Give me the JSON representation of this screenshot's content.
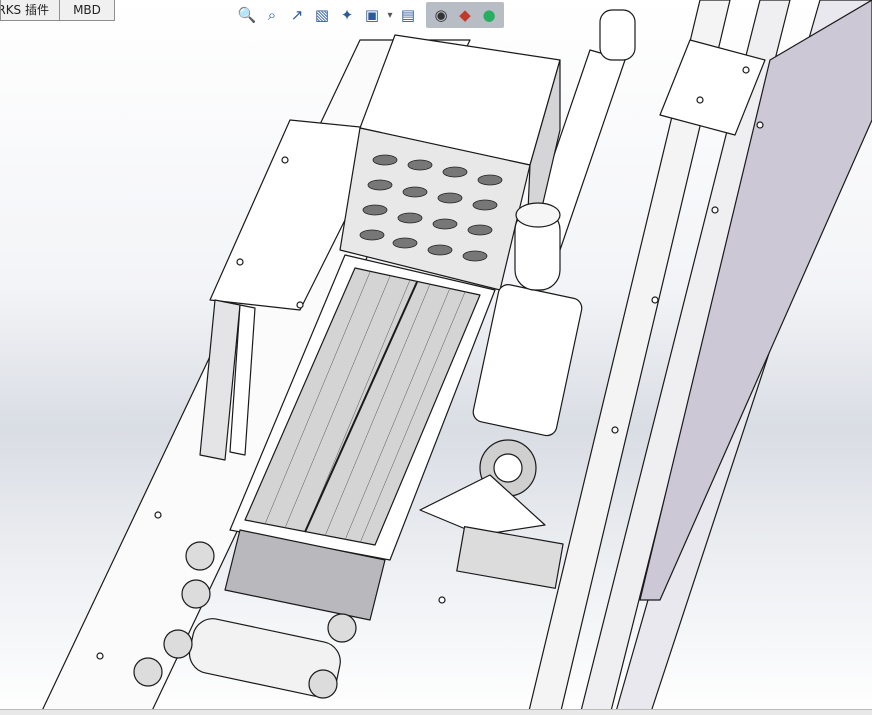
{
  "tabs": [
    {
      "label": "SOLIDWORKS 插件"
    },
    {
      "label": "MBD"
    }
  ],
  "hud_toolbar": {
    "icons": [
      "zoom-to-fit-icon",
      "zoom-area-icon",
      "previous-view-icon",
      "section-view-icon",
      "dynamic-annotation-icon",
      "view-orientation-icon",
      "display-style-icon",
      "hide-show-icon",
      "edit-appearance-icon",
      "apply-scene-icon"
    ]
  },
  "colors": {
    "background_top": "#ffffff",
    "background_mid": "#d9dde4",
    "edge": "#1a1a1a",
    "part_fill": "#ffffff",
    "shadow_fill": "#c9c9cf"
  }
}
